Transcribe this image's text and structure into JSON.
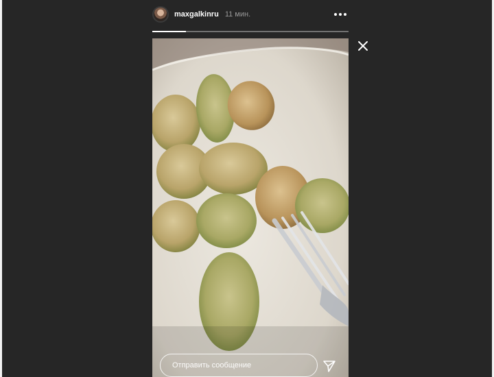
{
  "story": {
    "username": "maxgalkinru",
    "time_ago": "11 мин.",
    "progress_fraction": 0.17,
    "reply_placeholder": "Отправить сообщение"
  },
  "icons": {
    "more": "more-horizontal-icon",
    "close": "close-icon",
    "send": "send-paper-plane-icon"
  },
  "colors": {
    "background": "#262626",
    "text": "#ffffff",
    "muted_text": "#9a9a9a"
  }
}
